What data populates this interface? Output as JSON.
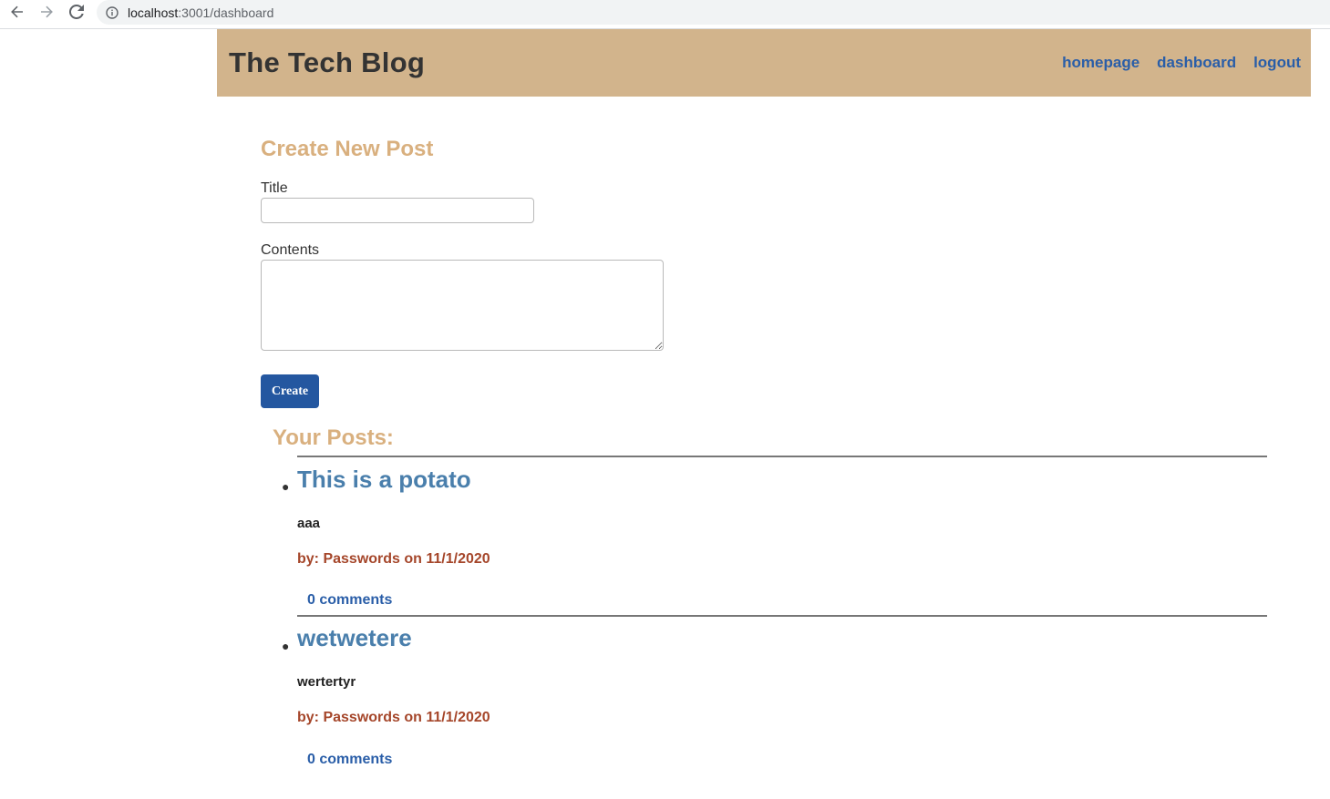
{
  "browser": {
    "url_host": "localhost",
    "url_path": ":3001/dashboard",
    "icons": [
      "back-arrow-icon",
      "forward-arrow-icon",
      "reload-icon",
      "info-icon"
    ]
  },
  "header": {
    "title": "The Tech Blog",
    "nav": {
      "homepage": "homepage",
      "dashboard": "dashboard",
      "logout": "logout"
    },
    "background_color": "#d2b48c"
  },
  "create_form": {
    "heading": "Create New Post",
    "title_label": "Title",
    "title_value": "",
    "contents_label": "Contents",
    "contents_value": "",
    "submit_label": "Create",
    "button_color": "#2457a0"
  },
  "posts_section": {
    "heading": "Your Posts:",
    "posts": [
      {
        "title": "This is a potato",
        "body": "aaa",
        "meta": "by: Passwords on 11/1/2020",
        "comments": "0 comments"
      },
      {
        "title": "wetwetere",
        "body": "wertertyr",
        "meta": "by: Passwords on 11/1/2020",
        "comments": "0 comments"
      }
    ]
  },
  "colors": {
    "heading_accent": "#d9b07f",
    "post_title": "#4a7fac",
    "post_meta": "#a5462a",
    "link": "#2a5ea8"
  }
}
